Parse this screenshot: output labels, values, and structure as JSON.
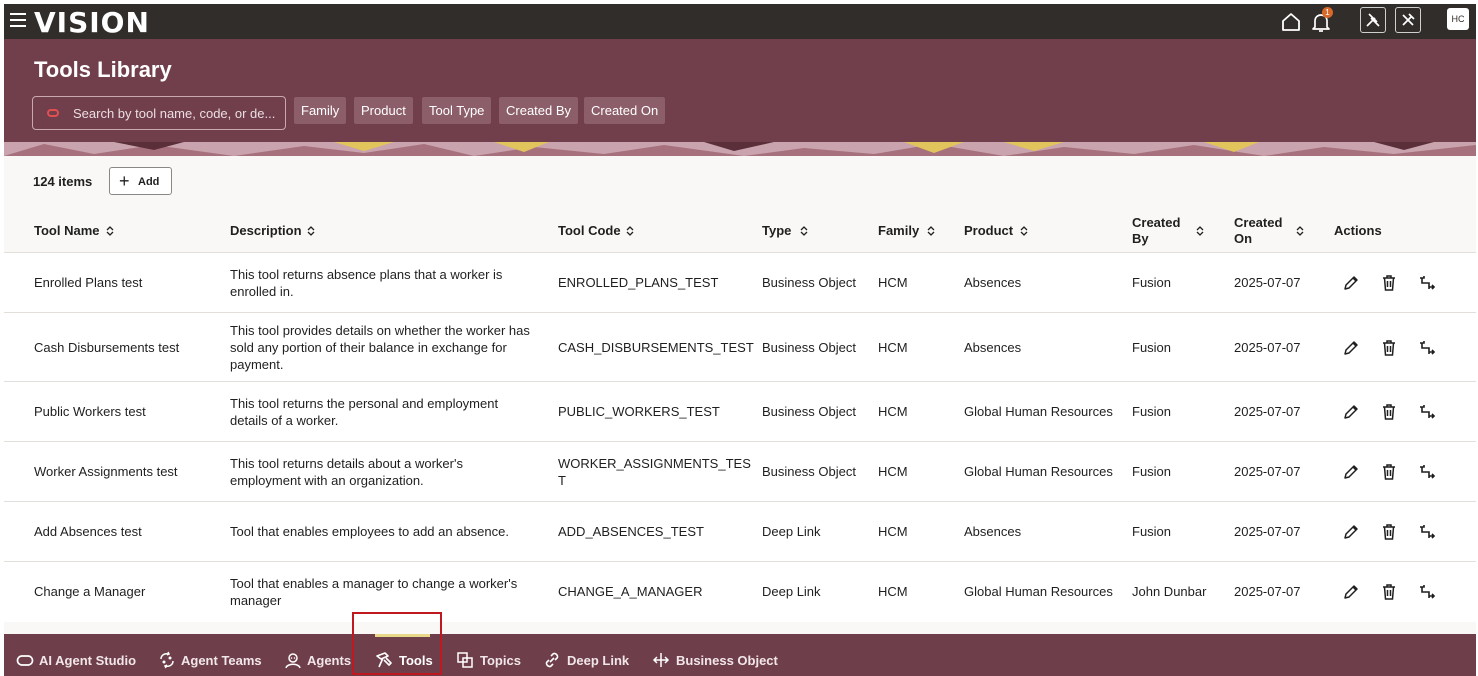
{
  "app": {
    "title": "VISION",
    "notification_count": "1",
    "avatar_initials": "HC"
  },
  "page": {
    "title": "Tools Library"
  },
  "search": {
    "placeholder": "Search by tool name, code, or de..."
  },
  "filters": [
    "Family",
    "Product",
    "Tool Type",
    "Created By",
    "Created On"
  ],
  "toolbar": {
    "count": "124 items",
    "add_label": "Add"
  },
  "columns": {
    "name": "Tool Name",
    "description": "Description",
    "code": "Tool Code",
    "type": "Type",
    "family": "Family",
    "product": "Product",
    "created_by_1": "Created",
    "created_by_2": "By",
    "created_on_1": "Created",
    "created_on_2": "On",
    "actions": "Actions"
  },
  "rows": [
    {
      "name": "Enrolled Plans test",
      "description": [
        "This tool returns absence plans that a worker is",
        "enrolled in."
      ],
      "code": [
        "ENROLLED_PLANS_TEST"
      ],
      "type": "Business Object",
      "family": "HCM",
      "product": "Absences",
      "created_by": "Fusion",
      "created_on": "2025-07-07"
    },
    {
      "name": "Cash Disbursements test",
      "description": [
        "This tool provides details on whether the worker has",
        "sold any portion of their balance in exchange for",
        "payment."
      ],
      "code": [
        "CASH_DISBURSEMENTS_TEST"
      ],
      "type": "Business Object",
      "family": "HCM",
      "product": "Absences",
      "created_by": "Fusion",
      "created_on": "2025-07-07"
    },
    {
      "name": "Public Workers test",
      "description": [
        "This tool returns the personal and employment",
        "details of a worker."
      ],
      "code": [
        "PUBLIC_WORKERS_TEST"
      ],
      "type": "Business Object",
      "family": "HCM",
      "product": "Global Human Resources",
      "created_by": "Fusion",
      "created_on": "2025-07-07"
    },
    {
      "name": "Worker Assignments test",
      "description": [
        "This tool returns details about a worker's",
        "employment with an organization."
      ],
      "code": [
        "WORKER_ASSIGNMENTS_TES",
        "T"
      ],
      "type": "Business Object",
      "family": "HCM",
      "product": "Global Human Resources",
      "created_by": "Fusion",
      "created_on": "2025-07-07"
    },
    {
      "name": "Add Absences test",
      "description": [
        "Tool that enables employees to add an absence."
      ],
      "code": [
        "ADD_ABSENCES_TEST"
      ],
      "type": "Deep Link",
      "family": "HCM",
      "product": "Absences",
      "created_by": "Fusion",
      "created_on": "2025-07-07"
    },
    {
      "name": "Change a Manager",
      "description": [
        "Tool that enables a manager to change a worker's",
        "manager"
      ],
      "code": [
        "CHANGE_A_MANAGER"
      ],
      "type": "Deep Link",
      "family": "HCM",
      "product": "Global Human Resources",
      "created_by": "John Dunbar",
      "created_on": "2025-07-07"
    }
  ],
  "bottom_nav": [
    {
      "label": "AI Agent Studio",
      "icon": "oracle-ring-icon"
    },
    {
      "label": "Agent Teams",
      "icon": "agent-teams-icon"
    },
    {
      "label": "Agents",
      "icon": "agents-icon"
    },
    {
      "label": "Tools",
      "icon": "tools-icon",
      "active": true
    },
    {
      "label": "Topics",
      "icon": "topics-icon"
    },
    {
      "label": "Deep Link",
      "icon": "deep-link-icon"
    },
    {
      "label": "Business Object",
      "icon": "business-object-icon"
    }
  ],
  "colors": {
    "topbar": "#312d2a",
    "header": "#713e4b",
    "bottom_nav": "#6e3e4a",
    "highlight_box": "#c0181f",
    "active_indicator": "#e8d98a"
  }
}
